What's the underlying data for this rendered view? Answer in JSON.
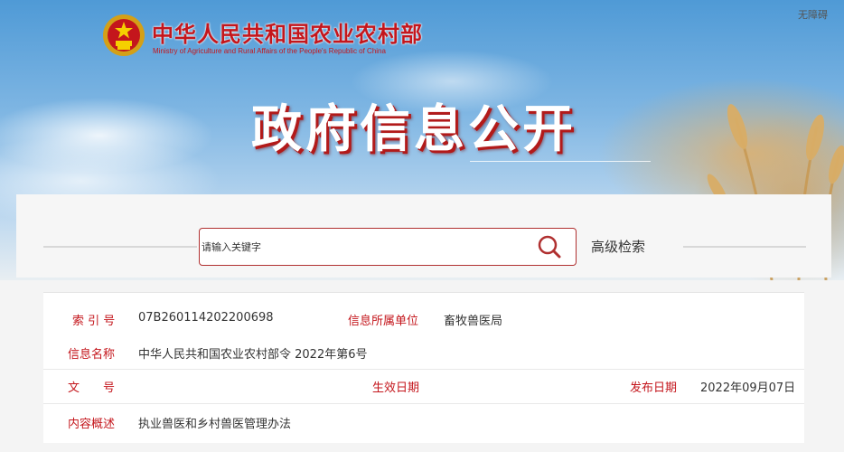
{
  "header": {
    "ministry_name_cn": "中华人民共和国农业农村部",
    "ministry_name_en": "Ministry of Agriculture and Rural Affairs of the People's Republic of China",
    "accessibility_link": "无障碍",
    "hero_title": "政府信息公开"
  },
  "search": {
    "placeholder": "请输入关键字",
    "advanced_label": "高级检索",
    "icon": "search-icon"
  },
  "info": {
    "index_label": "索 引 号",
    "index_value": "07B260114202200698",
    "unit_label": "信息所属单位",
    "unit_value": "畜牧兽医局",
    "name_label": "信息名称",
    "name_value": "中华人民共和国农业农村部令 2022年第6号",
    "doc_no_label": "文　　号",
    "effective_label": "生效日期",
    "publish_label": "发布日期",
    "publish_value": "2022年09月07日",
    "summary_label": "内容概述",
    "summary_value": "执业兽医和乡村兽医管理办法"
  },
  "colors": {
    "brand_red": "#c4161c",
    "sky_blue": "#4f9ad6"
  }
}
